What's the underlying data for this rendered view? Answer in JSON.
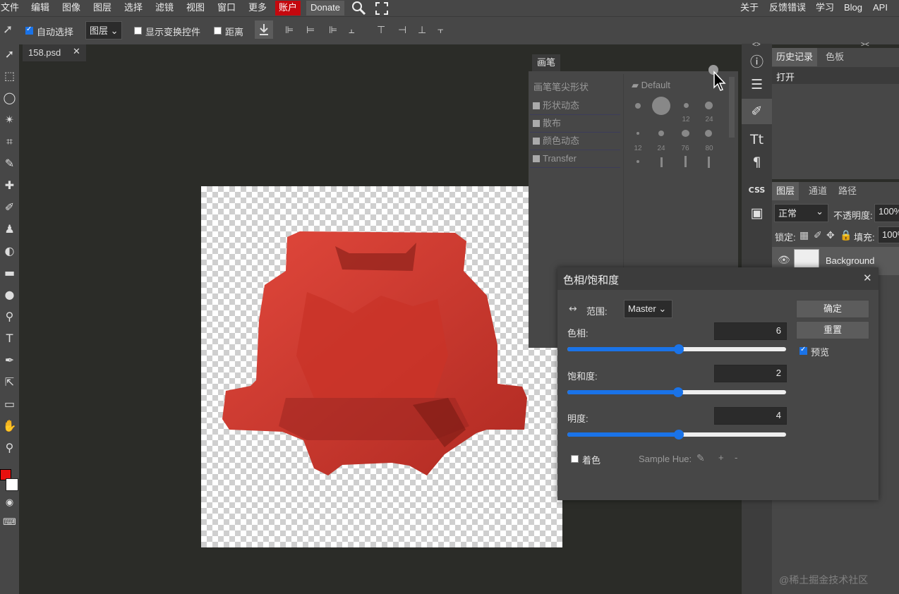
{
  "menu": {
    "left": [
      "文件",
      "编辑",
      "图像",
      "图层",
      "选择",
      "滤镜",
      "视图",
      "窗口",
      "更多"
    ],
    "account": "账户",
    "donate": "Donate",
    "search_icon": "search-icon",
    "fullscreen_icon": "fullscreen-icon",
    "right": [
      "关于",
      "反馈错误",
      "学习",
      "Blog",
      "API"
    ]
  },
  "options": {
    "auto_select_label": "自动选择",
    "auto_select_checked": true,
    "target_value": "图层",
    "show_transform_label": "显示变换控件",
    "distance_label": "距离"
  },
  "document": {
    "tab_title": "158.psd",
    "close_glyph": "✕"
  },
  "brush_panel": {
    "tab": "画笔",
    "header": "画笔笔尖形状",
    "items": [
      "形状动态",
      "散布",
      "颜色动态",
      "Transfer"
    ],
    "preset_folder": "Default",
    "size_labels_row1": [
      "12",
      "24"
    ],
    "size_labels_row2": [
      "12",
      "24",
      "76",
      "80"
    ]
  },
  "history_panel": {
    "tabs": [
      "历史记录",
      "色板"
    ],
    "items": [
      "打开"
    ]
  },
  "layers_panel": {
    "tabs": [
      "图层",
      "通道",
      "路径"
    ],
    "blend_mode": "正常",
    "opacity_label": "不透明度:",
    "opacity_value": "100%",
    "lock_label": "锁定:",
    "fill_label": "填充:",
    "fill_value": "100%",
    "layers": [
      "Background"
    ]
  },
  "hue_dialog": {
    "title": "色相/饱和度",
    "range_label": "范围:",
    "range_value": "Master",
    "ok": "确定",
    "reset": "重置",
    "preview_label": "预览",
    "preview_checked": true,
    "hue_label": "色相:",
    "hue_value": "6",
    "hue_level": 0.51,
    "sat_label": "饱和度:",
    "sat_value": "2",
    "sat_level": 0.505,
    "light_label": "明度:",
    "light_value": "4",
    "light_level": 0.51,
    "colorize_label": "着色",
    "sample_hue_label": "Sample Hue:",
    "plus": "+",
    "minus": "-"
  },
  "watermark": "@稀土掘金技术社区",
  "colors": {
    "foreground": "#e8100e",
    "background": "#ffffff",
    "object_red": "#d53b33",
    "accent": "#1a73e8"
  }
}
